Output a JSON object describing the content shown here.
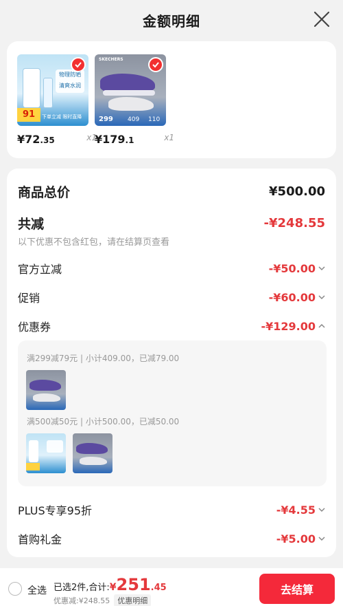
{
  "header": {
    "title": "金额明细"
  },
  "products": [
    {
      "price_main": "¥72",
      "price_dec": ".35",
      "qty": "x1",
      "thumb_texts": [
        "物理防晒",
        "清爽水润",
        "91",
        "下单立减 限时直降"
      ]
    },
    {
      "price_main": "¥179",
      "price_dec": ".1",
      "qty": "x1",
      "thumb_texts": [
        "SKECHERS",
        "299",
        "409",
        "110"
      ]
    }
  ],
  "summary": {
    "total_label": "商品总价",
    "total_value": "¥500.00",
    "discount_label": "共减",
    "discount_value": "-¥248.55",
    "note": "以下优惠不包含红包，请在结算页查看",
    "items": [
      {
        "label": "官方立减",
        "value": "-¥50.00"
      },
      {
        "label": "促销",
        "value": "-¥60.00"
      },
      {
        "label": "优惠券",
        "value": "-¥129.00"
      }
    ],
    "coupons": [
      {
        "text": "满299减79元 | 小计409.00，已减79.00"
      },
      {
        "text": "满500减50元 | 小计500.00，已减50.00"
      }
    ],
    "extra_items": [
      {
        "label": "PLUS专享95折",
        "value": "-¥4.55"
      },
      {
        "label": "首购礼金",
        "value": "-¥5.00"
      }
    ]
  },
  "bottom": {
    "select_all": "全选",
    "selected_text": "已选2件,合计:",
    "currency": "¥",
    "total_int": "251",
    "total_dec": ".45",
    "discount_text": "优惠减:¥248.55",
    "detail_tag": "优惠明细",
    "checkout_label": "去结算"
  },
  "colors": {
    "accent": "#f4293a",
    "price_red": "#e4393c"
  }
}
